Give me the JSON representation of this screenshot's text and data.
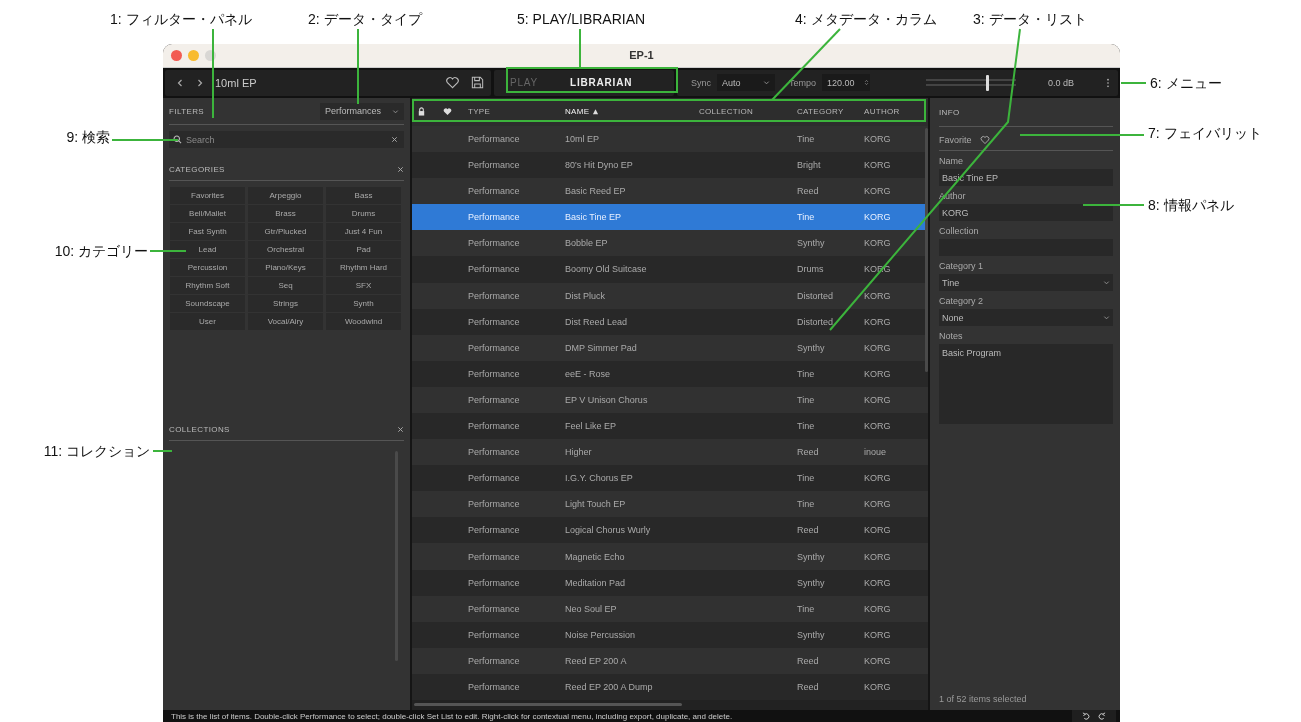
{
  "window": {
    "title": "EP-1"
  },
  "toolbar": {
    "current_item": "10ml EP",
    "mode_tabs": [
      {
        "label": "PLAY",
        "selected": false
      },
      {
        "label": "LIBRARIAN",
        "selected": true
      }
    ],
    "sync": {
      "label": "Sync",
      "value": "Auto"
    },
    "tempo": {
      "label": "Tempo",
      "value": "120.00"
    },
    "volume": {
      "level": 0.68,
      "reading": "0.0 dB"
    }
  },
  "filters": {
    "title": "FILTERS",
    "data_type": "Performances",
    "search": {
      "placeholder": "Search"
    }
  },
  "categories": {
    "title": "CATEGORIES",
    "items": [
      "Favorites",
      "Arpeggio",
      "Bass",
      "Bell/Mallet",
      "Brass",
      "Drums",
      "Fast Synth",
      "Gtr/Plucked",
      "Just 4 Fun",
      "Lead",
      "Orchestral",
      "Pad",
      "Percussion",
      "Piano/Keys",
      "Rhythm Hard",
      "Rhythm Soft",
      "Seq",
      "SFX",
      "Soundscape",
      "Strings",
      "Synth",
      "User",
      "Vocal/Airy",
      "Woodwind"
    ]
  },
  "collections": {
    "title": "COLLECTIONS"
  },
  "list": {
    "columns": [
      {
        "kind": "lock"
      },
      {
        "kind": "favorite"
      },
      {
        "kind": "text",
        "label": "TYPE",
        "sorted": false
      },
      {
        "kind": "text",
        "label": "NAME",
        "sorted": true
      },
      {
        "kind": "text",
        "label": "COLLECTION",
        "sorted": false
      },
      {
        "kind": "text",
        "label": "CATEGORY",
        "sorted": false
      },
      {
        "kind": "text",
        "label": "AUTHOR",
        "sorted": false
      }
    ],
    "rows": [
      {
        "type": "Performance",
        "name": "10ml EP",
        "category": "Tine",
        "author": "KORG",
        "selected": false
      },
      {
        "type": "Performance",
        "name": "80's Hit Dyno EP",
        "category": "Bright",
        "author": "KORG",
        "selected": false
      },
      {
        "type": "Performance",
        "name": "Basic Reed EP",
        "category": "Reed",
        "author": "KORG",
        "selected": false
      },
      {
        "type": "Performance",
        "name": "Basic Tine EP",
        "category": "Tine",
        "author": "KORG",
        "selected": true
      },
      {
        "type": "Performance",
        "name": "Bobble EP",
        "category": "Synthy",
        "author": "KORG",
        "selected": false
      },
      {
        "type": "Performance",
        "name": "Boomy Old Suitcase",
        "category": "Drums",
        "author": "KORG",
        "selected": false
      },
      {
        "type": "Performance",
        "name": "Dist Pluck",
        "category": "Distorted",
        "author": "KORG",
        "selected": false
      },
      {
        "type": "Performance",
        "name": "Dist Reed Lead",
        "category": "Distorted",
        "author": "KORG",
        "selected": false
      },
      {
        "type": "Performance",
        "name": "DMP Simmer Pad",
        "category": "Synthy",
        "author": "KORG",
        "selected": false
      },
      {
        "type": "Performance",
        "name": "eeE - Rose",
        "category": "Tine",
        "author": "KORG",
        "selected": false
      },
      {
        "type": "Performance",
        "name": "EP V Unison Chorus",
        "category": "Tine",
        "author": "KORG",
        "selected": false
      },
      {
        "type": "Performance",
        "name": "Feel Like EP",
        "category": "Tine",
        "author": "KORG",
        "selected": false
      },
      {
        "type": "Performance",
        "name": "Higher",
        "category": "Reed",
        "author": "inoue",
        "selected": false
      },
      {
        "type": "Performance",
        "name": "I.G.Y. Chorus EP",
        "category": "Tine",
        "author": "KORG",
        "selected": false
      },
      {
        "type": "Performance",
        "name": "Light Touch EP",
        "category": "Tine",
        "author": "KORG",
        "selected": false
      },
      {
        "type": "Performance",
        "name": "Logical Chorus Wurly",
        "category": "Reed",
        "author": "KORG",
        "selected": false
      },
      {
        "type": "Performance",
        "name": "Magnetic Echo",
        "category": "Synthy",
        "author": "KORG",
        "selected": false
      },
      {
        "type": "Performance",
        "name": "Meditation Pad",
        "category": "Synthy",
        "author": "KORG",
        "selected": false
      },
      {
        "type": "Performance",
        "name": "Neo Soul EP",
        "category": "Tine",
        "author": "KORG",
        "selected": false
      },
      {
        "type": "Performance",
        "name": "Noise Percussion",
        "category": "Synthy",
        "author": "KORG",
        "selected": false
      },
      {
        "type": "Performance",
        "name": "Reed EP 200 A",
        "category": "Reed",
        "author": "KORG",
        "selected": false
      },
      {
        "type": "Performance",
        "name": "Reed EP 200 A Dump",
        "category": "Reed",
        "author": "KORG",
        "selected": false
      }
    ]
  },
  "info": {
    "title": "INFO",
    "favorite_label": "Favorite",
    "fields": [
      {
        "kind": "text",
        "label": "Name",
        "value": "Basic Tine EP"
      },
      {
        "kind": "text",
        "label": "Author",
        "value": "KORG"
      },
      {
        "kind": "text",
        "label": "Collection"
      },
      {
        "kind": "select",
        "label": "Category 1",
        "value": "Tine"
      },
      {
        "kind": "select",
        "label": "Category 2",
        "value": "None"
      },
      {
        "kind": "textarea",
        "label": "Notes",
        "value": "Basic Program"
      }
    ],
    "selection_count": "1 of 52 items selected"
  },
  "status_bar": {
    "text": "This is the list of items. Double-click Performance to select; double-click Set List to edit. Right-click for contextual menu, including export, duplicate, and delete."
  },
  "annotations": [
    {
      "label": "1: フィルター・パネル"
    },
    {
      "label": "2: データ・タイプ"
    },
    {
      "label": "5: PLAY/LIBRARIAN"
    },
    {
      "label": "4: メタデータ・カラム"
    },
    {
      "label": "3: データ・リスト"
    },
    {
      "label": "6: メニュー"
    },
    {
      "label": "7: フェイバリット"
    },
    {
      "label": "8: 情報パネル"
    },
    {
      "label": "9: 検索"
    },
    {
      "label": "10: カテゴリー"
    },
    {
      "label": "11: コレクション"
    }
  ]
}
